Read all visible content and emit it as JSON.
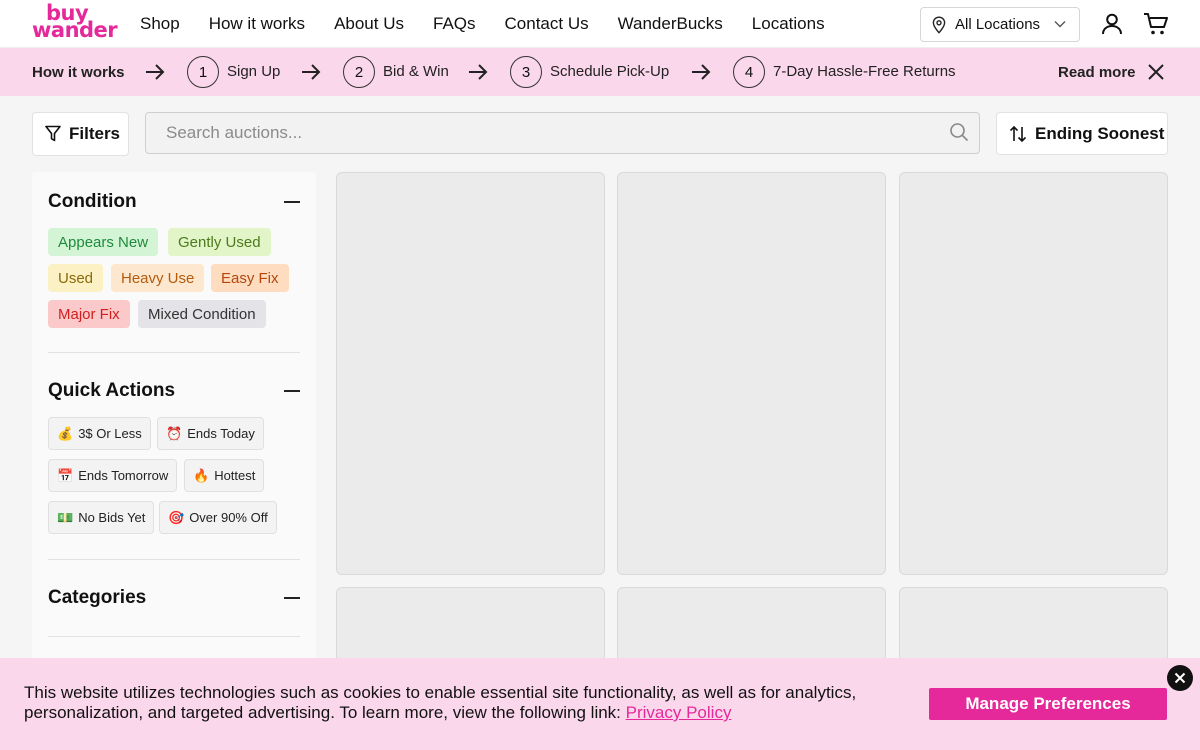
{
  "brand": {
    "logo_line1": "buy",
    "logo_line2": "wander",
    "accent": "#e5299a"
  },
  "nav": {
    "items": [
      "Shop",
      "How it works",
      "About Us",
      "FAQs",
      "Contact Us",
      "WanderBucks",
      "Locations"
    ],
    "location_select": "All Locations",
    "icons": [
      "location-pin-icon",
      "chevron-down-icon",
      "user-icon",
      "cart-icon"
    ]
  },
  "steps_banner": {
    "title": "How it works",
    "steps": [
      {
        "num": "1",
        "label": "Sign Up"
      },
      {
        "num": "2",
        "label": "Bid & Win"
      },
      {
        "num": "3",
        "label": "Schedule Pick-Up"
      },
      {
        "num": "4",
        "label": "7-Day Hassle-Free Returns"
      }
    ],
    "read_more": "Read more"
  },
  "toolbar": {
    "filters_label": "Filters",
    "search_placeholder": "Search auctions...",
    "sort_label": "Ending Soonest"
  },
  "sidebar": {
    "condition": {
      "title": "Condition",
      "chips": [
        {
          "label": "Appears New",
          "bg": "#d3f5d6",
          "fg": "#1f8a3b"
        },
        {
          "label": "Gently Used",
          "bg": "#e1f5c8",
          "fg": "#4d7a1a"
        },
        {
          "label": "Used",
          "bg": "#fbf1c4",
          "fg": "#8a6a0a"
        },
        {
          "label": "Heavy Use",
          "bg": "#fde8cf",
          "fg": "#b45b0e"
        },
        {
          "label": "Easy Fix",
          "bg": "#fddcc0",
          "fg": "#b4470e"
        },
        {
          "label": "Major Fix",
          "bg": "#fbc9c9",
          "fg": "#d01f1f"
        },
        {
          "label": "Mixed Condition",
          "bg": "#e3e3e8",
          "fg": "#333333"
        }
      ]
    },
    "quick_actions": {
      "title": "Quick Actions",
      "items": [
        {
          "emoji": "💰",
          "label": "3$ Or Less"
        },
        {
          "emoji": "⏰",
          "label": "Ends Today"
        },
        {
          "emoji": "📅",
          "label": "Ends Tomorrow"
        },
        {
          "emoji": "🔥",
          "label": "Hottest"
        },
        {
          "emoji": "💵",
          "label": "No Bids Yet"
        },
        {
          "emoji": "🎯",
          "label": "Over 90% Off"
        }
      ]
    },
    "categories": {
      "title": "Categories"
    }
  },
  "cookie_banner": {
    "text": "This website utilizes technologies such as cookies to enable essential site functionality, as well as for analytics, personalization, and targeted advertising. To learn more, view the following link: ",
    "link_text": "Privacy Policy",
    "button_label": "Manage Preferences"
  }
}
